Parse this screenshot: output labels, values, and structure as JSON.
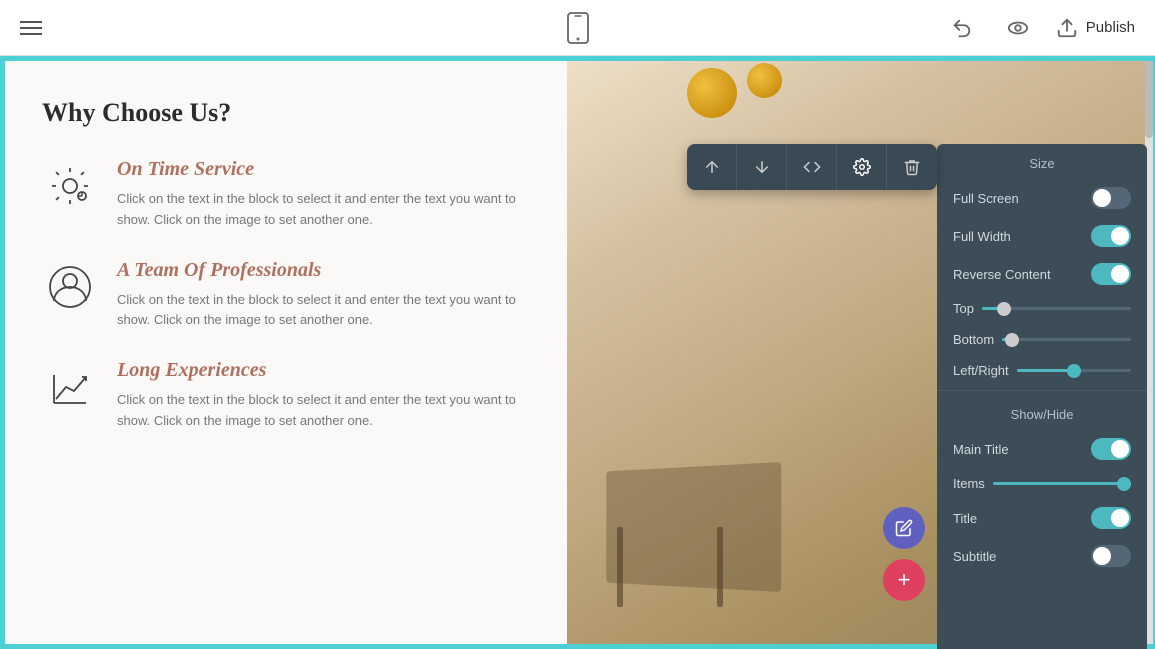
{
  "header": {
    "publish_label": "Publish",
    "hamburger_label": "Menu"
  },
  "toolbar": {
    "move_up_label": "Move Up",
    "move_down_label": "Move Down",
    "code_label": "Code",
    "settings_label": "Settings",
    "delete_label": "Delete"
  },
  "canvas": {
    "section_title": "Why Choose Us?",
    "features": [
      {
        "title": "On Time Service",
        "description": "Click on the text in the block to select it and enter the text you want to show. Click on the image to set another one."
      },
      {
        "title": "A Team Of Professionals",
        "description": "Click on the text in the block to select it and enter the text you want to show. Click on the image to set another one."
      },
      {
        "title": "Long Experiences",
        "description": "Click on the text in the block to select it and enter the text you want to show. Click on the image to set another one."
      }
    ]
  },
  "settings_panel": {
    "size_label": "Size",
    "show_hide_label": "Show/Hide",
    "full_screen_label": "Full Screen",
    "full_width_label": "Full Width",
    "reverse_content_label": "Reverse Content",
    "top_label": "Top",
    "bottom_label": "Bottom",
    "left_right_label": "Left/Right",
    "main_title_label": "Main Title",
    "items_label": "Items",
    "title_label": "Title",
    "subtitle_label": "Subtitle",
    "toggles": {
      "full_screen": "off",
      "full_width": "on",
      "reverse_content": "on",
      "main_title": "on",
      "items": "on",
      "title": "on",
      "subtitle": "off"
    },
    "sliders": {
      "top_value": 10,
      "bottom_value": 5,
      "left_right_value": 50
    }
  }
}
